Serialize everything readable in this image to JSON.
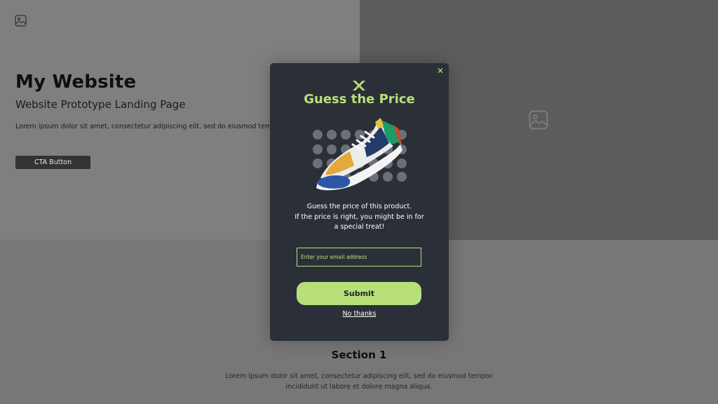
{
  "site": {
    "title": "My Website",
    "subtitle": "Website Prototype Landing Page",
    "body": "Lorem ipsum dolor sit amet, consectetur adipiscing elit, sed do eiusmod tempor incididunt ut labore et dolore magna aliqua.",
    "cta_label": "CTA Button",
    "section": {
      "title": "Section 1",
      "body": "Lorem ipsum dolor sit amet, consectetur adipiscing elit, sed do eiusmod tempor incididunt ut labore et dolore magna aliqua."
    },
    "icons": [
      "image-placeholder-icon",
      "image-placeholder-icon"
    ]
  },
  "popup": {
    "close_icon": "✕",
    "logo_icon": "brand-x-logo-icon",
    "title": "Guess the Price",
    "description": [
      "Guess the price of this product.",
      "If the price is right, you might be in for",
      "a special treat!"
    ],
    "email_placeholder": "Enter your email address",
    "email_value": "",
    "submit_label": "Submit",
    "dismiss_label": "No thanks"
  },
  "colors": {
    "accent": "#b7e07a",
    "popup_bg": "#2b3038",
    "hero_left": "#7f7f7f",
    "hero_right": "#5c5c5c",
    "section_bg": "#777777"
  }
}
